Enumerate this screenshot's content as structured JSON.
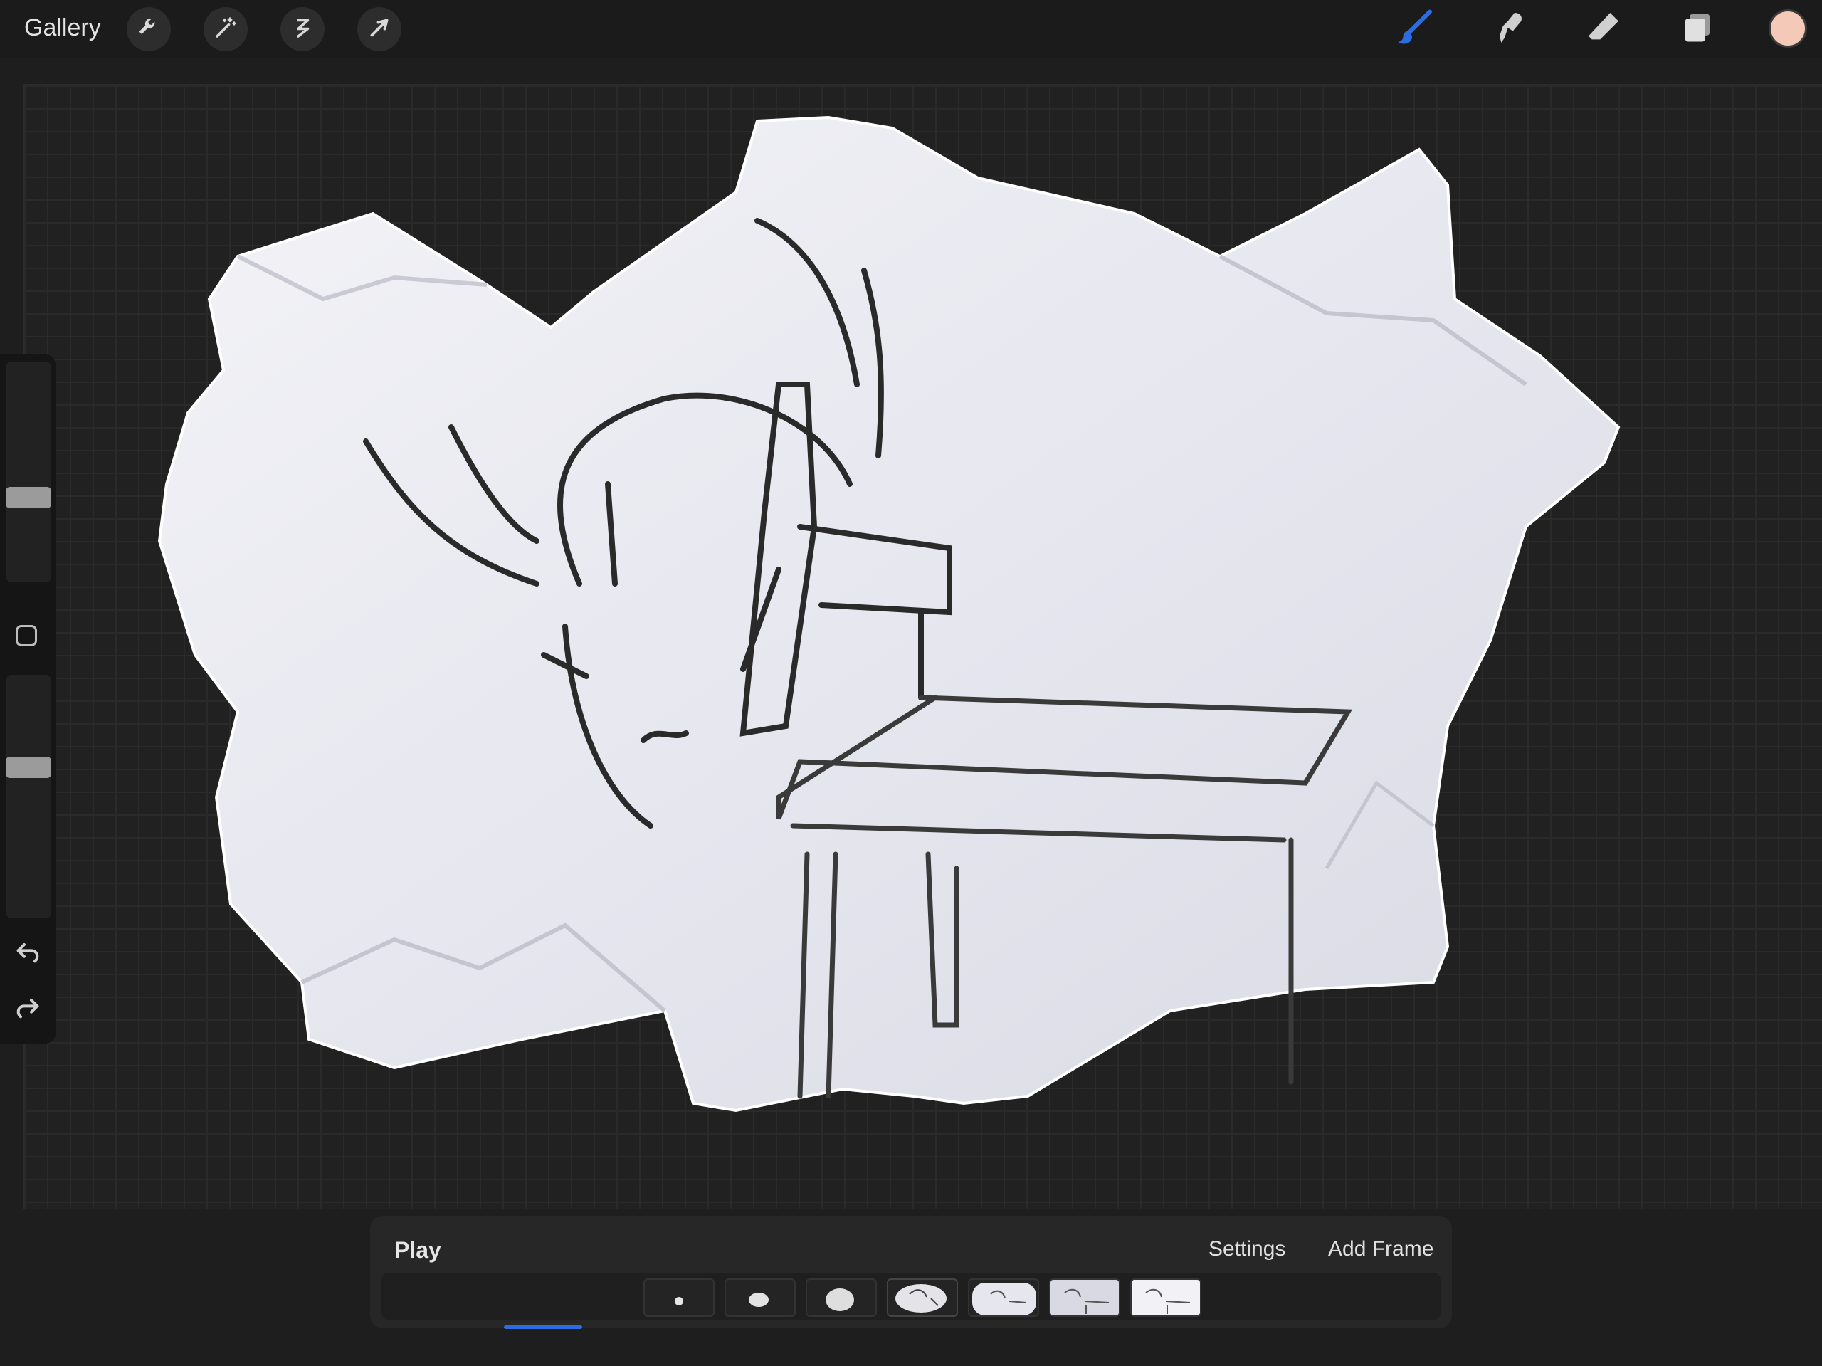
{
  "app": {
    "gallery_label": "Gallery"
  },
  "toolbar_left": [
    {
      "name": "wrench-icon",
      "label": "Actions"
    },
    {
      "name": "magic-wand-icon",
      "label": "Adjustments"
    },
    {
      "name": "selection-icon",
      "label": "Selection"
    },
    {
      "name": "transform-arrow-icon",
      "label": "Transform"
    }
  ],
  "toolbar_right": [
    {
      "name": "brush-icon",
      "label": "Paint",
      "active": true
    },
    {
      "name": "smudge-icon",
      "label": "Smudge"
    },
    {
      "name": "eraser-icon",
      "label": "Erase"
    },
    {
      "name": "layers-icon",
      "label": "Layers"
    }
  ],
  "colors": {
    "current_color": "#f4c9b8",
    "accent_blue": "#2b6de0",
    "sidebar_bg": "#151515"
  },
  "sidebar": {
    "brush_size_level": 0.37,
    "opacity_level": 0.63
  },
  "timeline": {
    "play_label": "Play",
    "settings_label": "Settings",
    "add_frame_label": "Add Frame",
    "frames": [
      {
        "index": 1
      },
      {
        "index": 2
      },
      {
        "index": 3
      },
      {
        "index": 4,
        "selected": true
      },
      {
        "index": 5
      },
      {
        "index": 6
      },
      {
        "index": 7
      }
    ]
  }
}
